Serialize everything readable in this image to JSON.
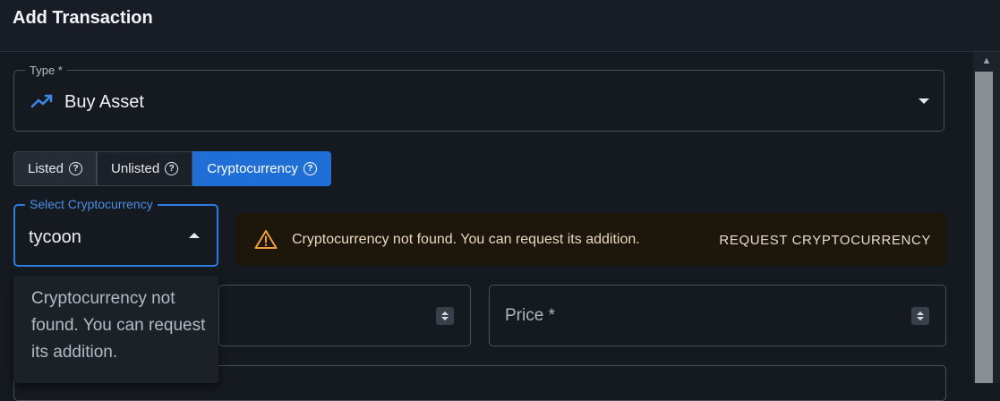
{
  "header": {
    "title": "Add Transaction"
  },
  "type_field": {
    "label": "Type *",
    "value": "Buy Asset",
    "icon": "trending-up-icon"
  },
  "asset_toggle": {
    "options": [
      {
        "label": "Listed",
        "selected": false
      },
      {
        "label": "Unlisted",
        "selected": false
      },
      {
        "label": "Cryptocurrency",
        "selected": true
      }
    ]
  },
  "crypto_select": {
    "label": "Select Cryptocurrency",
    "value": "tycoon",
    "no_options_text": "Cryptocurrency not found. You can request its addition."
  },
  "alert": {
    "message": "Cryptocurrency not found. You can request its addition.",
    "action_label": "REQUEST CRYPTOCURRENCY",
    "icon": "warning-icon"
  },
  "price_field": {
    "label": "Price *"
  },
  "colors": {
    "accent": "#1f6fd6",
    "warning": "#f0a040",
    "background": "#151a21"
  }
}
